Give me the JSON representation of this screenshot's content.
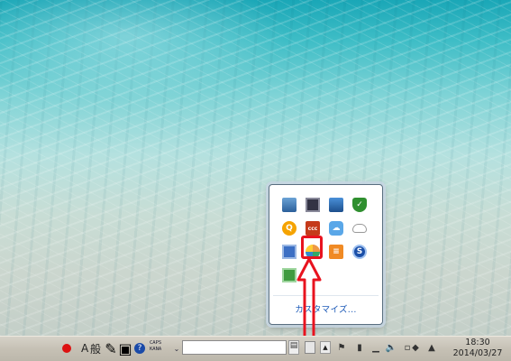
{
  "tray_popup": {
    "icons": [
      "network-adapter-icon",
      "monitor-icon",
      "computer-network-icon",
      "security-shield-icon",
      "orange-q-icon",
      "ccc-icon",
      "blue-cloud-icon",
      "cloud-outline-icon",
      "camera-icon",
      "pinwheel-icon",
      "orange-document-icon",
      "s-logo-icon",
      "green-box-icon"
    ],
    "highlighted_icon": "s-logo-icon",
    "customize_label": "カスタマイズ..."
  },
  "taskbar": {
    "ime_mode_label": "A",
    "ime_input_label": "般",
    "caps_label": "CAPS",
    "kana_label": "KANA",
    "search_value": "",
    "clock": {
      "time": "18:30",
      "date": "2014/03/27"
    }
  },
  "annotation": {
    "color": "#e8131f"
  }
}
